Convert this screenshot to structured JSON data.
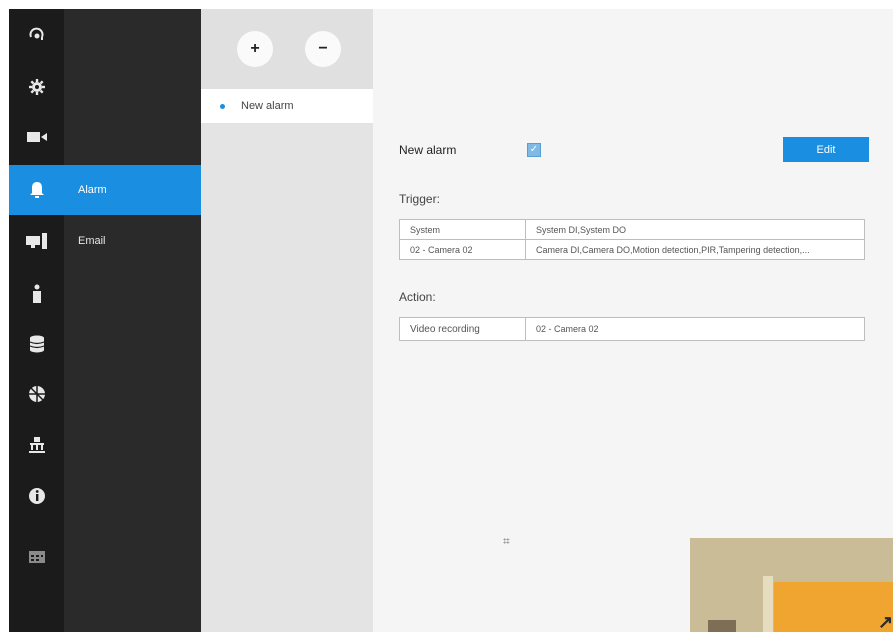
{
  "nav": {
    "icons": [
      {
        "name": "home-icon"
      },
      {
        "name": "gear-icon"
      },
      {
        "name": "video-camera-icon"
      },
      {
        "name": "bell-icon"
      },
      {
        "name": "computer-icon"
      },
      {
        "name": "person-icon"
      },
      {
        "name": "database-icon"
      },
      {
        "name": "network-icon"
      },
      {
        "name": "bank-icon"
      },
      {
        "name": "info-icon"
      },
      {
        "name": "calendar-icon"
      }
    ],
    "active": "bell-icon",
    "accent_color": "#1a8ee0"
  },
  "submenu": {
    "items": [
      {
        "label": "Alarm",
        "active": true
      },
      {
        "label": "Email",
        "active": false
      }
    ]
  },
  "alarm_list": {
    "add_label": "+",
    "remove_label": "−",
    "items": [
      {
        "label": "New alarm",
        "selected": true
      }
    ]
  },
  "detail": {
    "title": "New alarm",
    "enabled": true,
    "enabled_label": "",
    "edit_label": "Edit",
    "trigger_heading": "Trigger:",
    "trigger_rows": [
      [
        "System",
        "System DI,System DO"
      ],
      [
        "02 - Camera 02",
        "Camera DI,Camera DO,Motion detection,PIR,Tampering detection,..."
      ]
    ],
    "action_heading": "Action:",
    "action_rows": [
      [
        "Video recording",
        "02 - Camera 02"
      ]
    ]
  }
}
